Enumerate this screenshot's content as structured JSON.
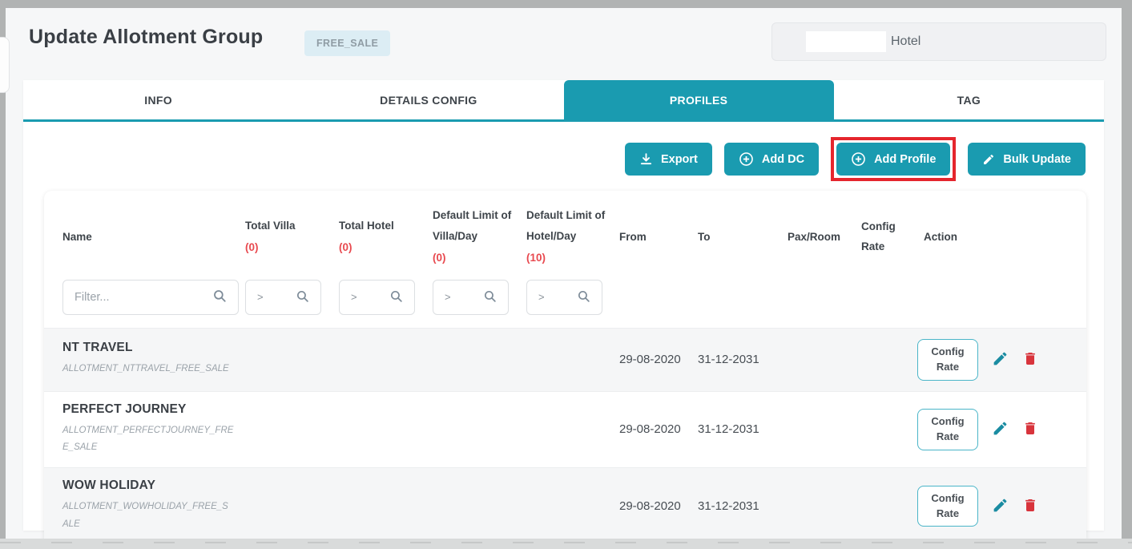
{
  "header": {
    "title": "Update Allotment Group",
    "badge": "FREE_SALE",
    "hotel_label": "Hotel"
  },
  "tabs": [
    {
      "label": "INFO",
      "active": false
    },
    {
      "label": "DETAILS CONFIG",
      "active": false
    },
    {
      "label": "PROFILES",
      "active": true
    },
    {
      "label": "TAG",
      "active": false
    }
  ],
  "toolbar": {
    "export_label": "Export",
    "add_dc_label": "Add DC",
    "add_profile_label": "Add Profile",
    "bulk_update_label": "Bulk Update"
  },
  "table": {
    "columns": [
      {
        "label": "Name"
      },
      {
        "label": "Total Villa",
        "count": "(0)"
      },
      {
        "label": "Total Hotel",
        "count": "(0)"
      },
      {
        "label": "Default Limit of Villa/Day",
        "count": "(0)"
      },
      {
        "label": "Default Limit of Hotel/Day",
        "count": "(10)"
      },
      {
        "label": "From"
      },
      {
        "label": "To"
      },
      {
        "label": "Pax/Room"
      },
      {
        "label": "Config Rate"
      },
      {
        "label": "Action"
      }
    ],
    "filter_placeholder": "Filter...",
    "numeric_filter_operator": ">",
    "config_rate_button": "Config Rate",
    "rows": [
      {
        "name": "NT TRAVEL",
        "code": "ALLOTMENT_NTTRAVEL_FREE_SALE",
        "from": "29-08-2020",
        "to": "31-12-2031"
      },
      {
        "name": "PERFECT JOURNEY",
        "code": "ALLOTMENT_PERFECTJOURNEY_FREE_SALE",
        "from": "29-08-2020",
        "to": "31-12-2031"
      },
      {
        "name": "WOW HOLIDAY",
        "code": "ALLOTMENT_WOWHOLIDAY_FREE_SALE",
        "from": "29-08-2020",
        "to": "31-12-2031"
      }
    ]
  },
  "colors": {
    "accent": "#1a9bb0",
    "danger": "#d8343c",
    "annotation": "#e5262d",
    "count_red": "#e8494f",
    "badge_bg": "#dcedf4"
  }
}
